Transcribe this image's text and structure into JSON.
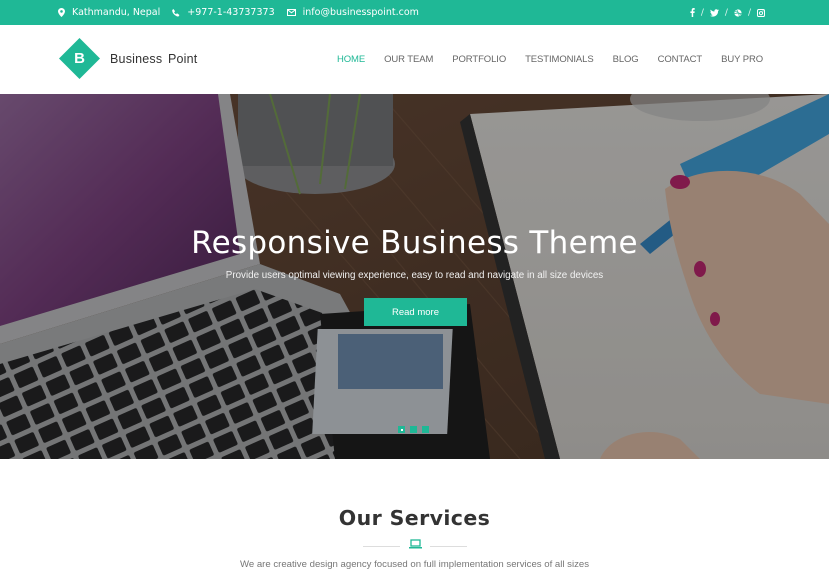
{
  "brand": {
    "name": "Business Point",
    "logo_letter": "B",
    "accent_color": "#1fb896"
  },
  "topbar": {
    "location": {
      "icon": "map-marker-icon",
      "text": "Kathmandu, Nepal"
    },
    "phone": {
      "icon": "phone-icon",
      "text": "+977-1-43737373"
    },
    "email": {
      "icon": "envelope-icon",
      "text": "info@businesspoint.com"
    },
    "social": [
      {
        "name": "facebook",
        "icon": "facebook-icon",
        "glyph": "f"
      },
      {
        "name": "twitter",
        "icon": "twitter-icon"
      },
      {
        "name": "dribbble",
        "icon": "dribbble-icon"
      },
      {
        "name": "instagram",
        "icon": "instagram-icon"
      }
    ],
    "separator": "/"
  },
  "nav": {
    "items": [
      {
        "label": "HOME",
        "active": true
      },
      {
        "label": "OUR TEAM",
        "active": false
      },
      {
        "label": "PORTFOLIO",
        "active": false
      },
      {
        "label": "TESTIMONIALS",
        "active": false
      },
      {
        "label": "BLOG",
        "active": false
      },
      {
        "label": "CONTACT",
        "active": false
      },
      {
        "label": "BUY PRO",
        "active": false
      }
    ]
  },
  "hero": {
    "title": "Responsive Business Theme",
    "subtitle": "Provide users optimal viewing experience, easy to read and navigate in all size devices",
    "button_label": "Read more",
    "slides_count": 3,
    "active_slide": 1
  },
  "services": {
    "title": "Our Services",
    "divider_icon": "laptop-icon",
    "subtitle": "We are creative design agency focused on full implementation services of all sizes"
  }
}
